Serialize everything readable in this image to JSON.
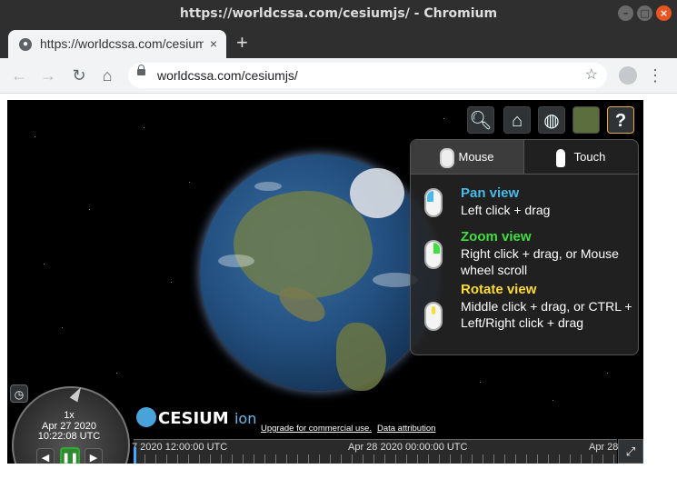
{
  "window": {
    "title": "https://worldcssa.com/cesiumjs/ - Chromium"
  },
  "tab": {
    "title": "https://worldcssa.com/cesiumjs/",
    "close": "×",
    "new_tab": "+"
  },
  "address_bar": {
    "url": "worldcssa.com/cesiumjs/"
  },
  "cesium_toolbar": {
    "buttons": [
      "geocoder-search",
      "home",
      "scene-mode-3d",
      "base-layer-picker",
      "navigation-help"
    ],
    "help_label": "?"
  },
  "help_panel": {
    "tabs": {
      "mouse": "Mouse",
      "touch": "Touch"
    },
    "sections": [
      {
        "title": "Pan view",
        "text": "Left click + drag",
        "color": "#48b9e8"
      },
      {
        "title": "Zoom view",
        "text": "Right click + drag, or Mouse wheel scroll",
        "color": "#41de3f"
      },
      {
        "title": "Rotate view",
        "text": "Middle click + drag, or CTRL + Left/Right click + drag",
        "color": "#fedc31"
      }
    ]
  },
  "animation": {
    "speed": "1x",
    "date": "Apr 27 2020",
    "time": "10:22:08 UTC"
  },
  "credits": {
    "logo": "CESIUM",
    "logo_suffix": "ion",
    "upgrade": "Upgrade for commercial use.",
    "attribution": "Data attribution"
  },
  "timeline": {
    "labels": [
      "7 2020 12:00:00 UTC",
      "Apr 28 2020 00:00:00 UTC",
      "Apr 28"
    ]
  }
}
